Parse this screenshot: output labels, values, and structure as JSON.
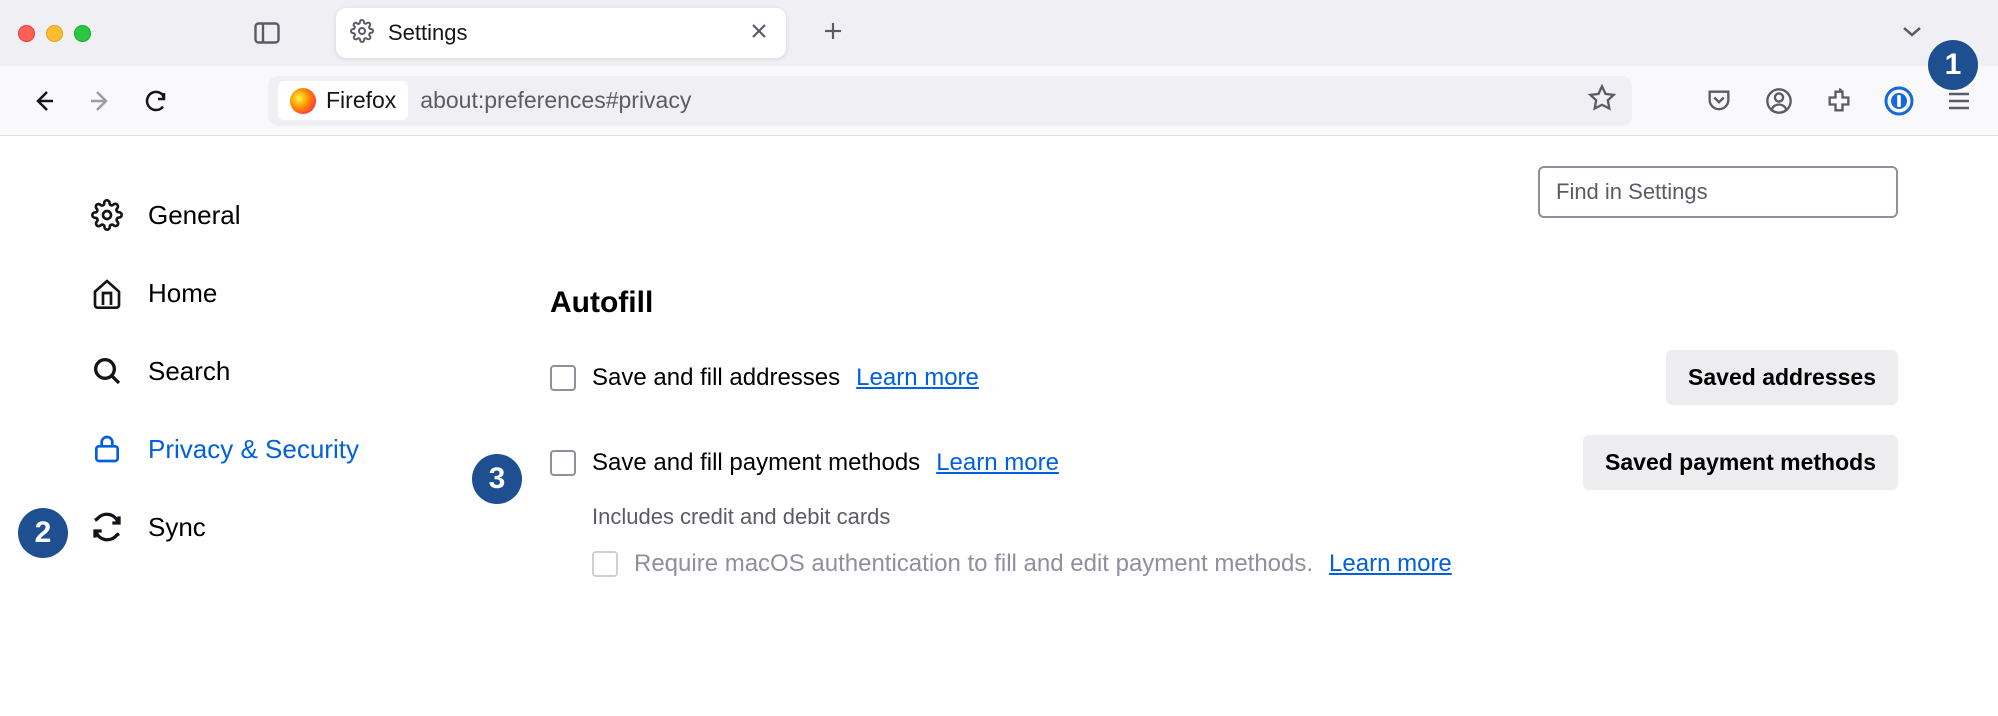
{
  "window": {
    "tab_title": "Settings",
    "url_identity": "Firefox",
    "url": "about:preferences#privacy"
  },
  "sidebar": {
    "items": [
      {
        "label": "General"
      },
      {
        "label": "Home"
      },
      {
        "label": "Search"
      },
      {
        "label": "Privacy & Security"
      },
      {
        "label": "Sync"
      }
    ]
  },
  "main": {
    "search_placeholder": "Find in Settings",
    "section_title": "Autofill",
    "addr_label": "Save and fill addresses",
    "addr_learn": "Learn more",
    "addr_btn": "Saved addresses",
    "pay_label": "Save and fill payment methods",
    "pay_learn": "Learn more",
    "pay_btn": "Saved payment methods",
    "pay_desc": "Includes credit and debit cards",
    "auth_label": "Require macOS authentication to fill and edit payment methods.",
    "auth_learn": "Learn more"
  },
  "callouts": {
    "c1": "1",
    "c2": "2",
    "c3": "3"
  }
}
